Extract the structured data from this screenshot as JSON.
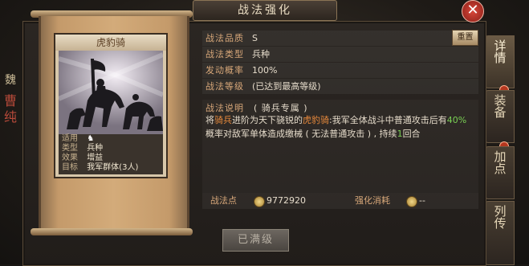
{
  "title": "战法强化",
  "close_icon": "close-icon",
  "left_strip": [
    "魏",
    "曹",
    "纯"
  ],
  "right_tabs": [
    {
      "label": "详情",
      "active": true
    },
    {
      "label": "装备",
      "active": false
    },
    {
      "label": "加点",
      "active": false
    },
    {
      "label": "列传",
      "active": false
    }
  ],
  "card": {
    "title": "虎豹骑",
    "art_icon": "cavalry-illustration-icon",
    "info": [
      {
        "key": "适用",
        "value": ""
      },
      {
        "key": "类型",
        "value": "兵种"
      },
      {
        "key": "效果",
        "value": "增益"
      },
      {
        "key": "目标",
        "value": "我军群体(3人)"
      }
    ]
  },
  "reset_label": "重置",
  "rows": [
    {
      "label": "战法品质",
      "value": "S"
    },
    {
      "label": "战法类型",
      "value": "兵种"
    },
    {
      "label": "发动概率",
      "value": "100%"
    },
    {
      "label": "战法等级",
      "value": "(已达到最高等级)"
    }
  ],
  "desc": {
    "label": "战法说明",
    "sub": "( 骑兵专属 )",
    "p1": "将",
    "h1": "骑兵",
    "p2": "进阶为天下骁锐的",
    "h2": "虎豹骑",
    "p3": ":我军全体战斗中普通攻击后有",
    "h3": "40%",
    "p4": "概率对敌军单体造成缴械 ( 无法普通攻击 ) , 持续",
    "h4": "1",
    "p5": "回合"
  },
  "points_label": "战法点",
  "points_value": "9772920",
  "cost_label": "强化消耗",
  "cost_value": "--",
  "max_button_label": "已满级",
  "colors": {
    "accent": "#d7a779",
    "highlight_orange": "#e7893c",
    "highlight_green": "#79cf54",
    "close": "#c5372a"
  }
}
